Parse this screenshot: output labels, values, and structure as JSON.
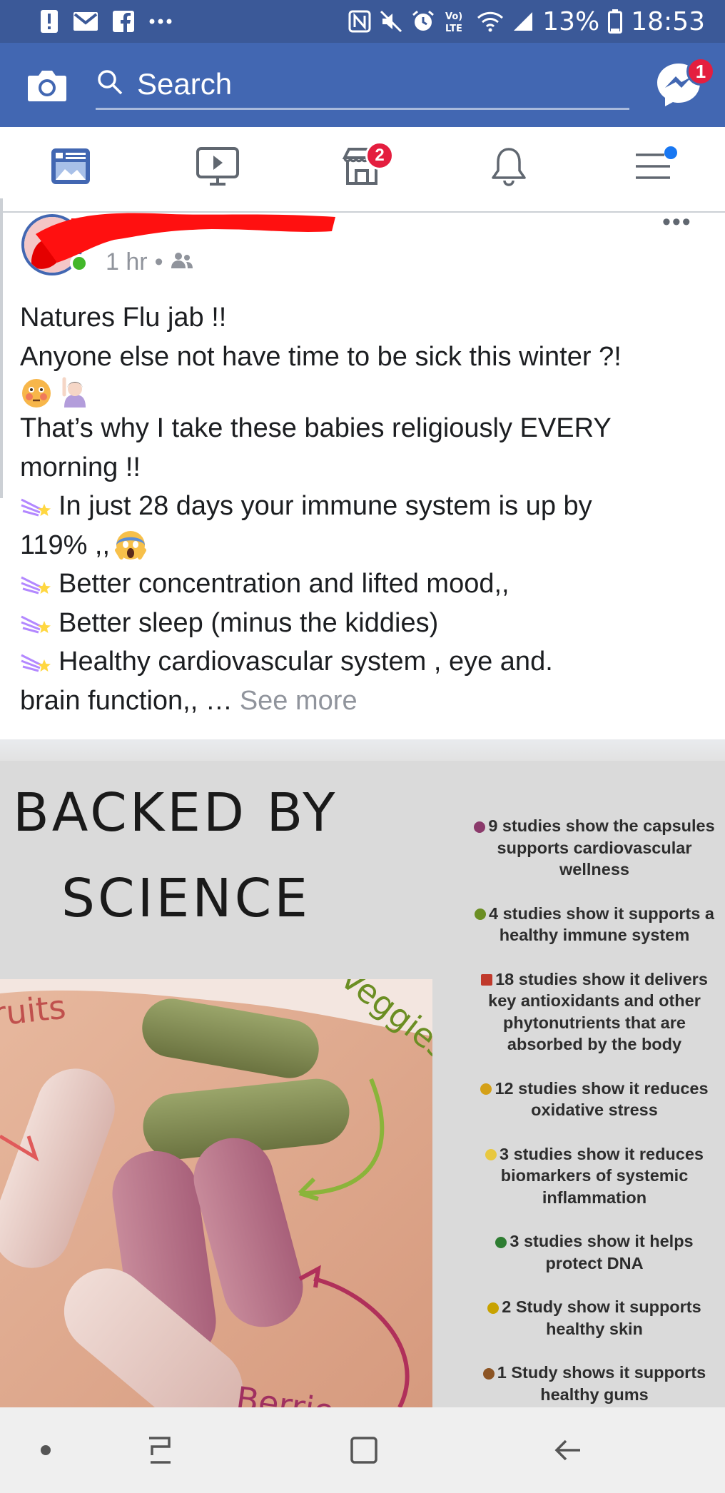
{
  "status_bar": {
    "icons_left": [
      "alert-icon",
      "gmail-icon",
      "facebook-icon",
      "more-notifications-icon"
    ],
    "icons_right": [
      "nfc-icon",
      "mute-icon",
      "alarm-icon",
      "volte-icon",
      "wifi-icon",
      "signal-icon"
    ],
    "battery": "13%",
    "time": "18:53"
  },
  "app_bar": {
    "search_placeholder": "Search",
    "messenger_badge": "1",
    "accent_color": "#4267b2"
  },
  "tabs": [
    {
      "name": "news-feed",
      "icon": "news-feed-icon",
      "active": true
    },
    {
      "name": "watch",
      "icon": "watch-icon"
    },
    {
      "name": "marketplace",
      "icon": "marketplace-icon",
      "badge": "2"
    },
    {
      "name": "notifications",
      "icon": "bell-icon"
    },
    {
      "name": "menu",
      "icon": "menu-icon",
      "dot": true
    }
  ],
  "post": {
    "time": "1 hr",
    "separator": "•",
    "audience_icon": "friends-icon",
    "more": "•••",
    "lines": [
      "Natures Flu jab !!",
      "Anyone else not have time to be sick this winter  ?!",
      "That’s why I take these babies religiously EVERY",
      "morning !!",
      "In just 28 days your immune system is up by",
      "119% ,, ",
      "Better concentration and lifted mood,,",
      "Better sleep (minus the kiddies)",
      "Healthy cardiovascular system , eye and.",
      "brain function,, … "
    ],
    "see_more": "See more"
  },
  "attachment": {
    "heading_line1": "BACKED BY",
    "heading_line2": "SCIENCE",
    "photo_labels": [
      "ruits",
      "Veggies",
      "Berrie"
    ],
    "studies": [
      {
        "text": "9 studies show the capsules supports cardiovascular wellness",
        "color": "#8b3a6b"
      },
      {
        "text": "4 studies show it supports a healthy immune system",
        "color": "#6b8e23"
      },
      {
        "text": "18 studies show it delivers key antioxidants and other phytonutrients that are absorbed by the body",
        "color": "#c0392b"
      },
      {
        "text": "12 studies show it reduces oxidative stress",
        "color": "#d4a017"
      },
      {
        "text": "3 studies show it reduces biomarkers of systemic inflammation",
        "color": "#e8c840"
      },
      {
        "text": "3 studies show it helps protect DNA",
        "color": "#2e7d32"
      },
      {
        "text": "2 Study show it supports healthy skin",
        "color": "#c8a200"
      },
      {
        "text": "1 Study shows it supports healthy gums",
        "color": "#8d5524"
      }
    ]
  },
  "nav_bar": {
    "buttons": [
      "dot-icon",
      "recent-apps-icon",
      "home-icon",
      "back-icon"
    ]
  }
}
